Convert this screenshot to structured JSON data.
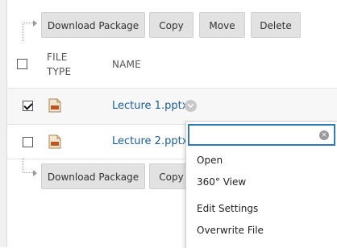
{
  "toolbar_top": {
    "download_label": "Download Package",
    "copy_label": "Copy",
    "move_label": "Move",
    "delete_label": "Delete"
  },
  "table": {
    "col_type_line1": "FILE",
    "col_type_line2": "TYPE",
    "col_name": "NAME",
    "rows": [
      {
        "name": "Lecture 1.pptx",
        "checked": true
      },
      {
        "name": "Lecture 2.pptx",
        "checked": false
      }
    ]
  },
  "toolbar_bottom": {
    "download_label": "Download Package",
    "copy_label": "Copy"
  },
  "context_menu": {
    "search_value": "",
    "clear_symbol": "×",
    "items": [
      "Open",
      "360° View",
      "Edit Settings",
      "Overwrite File"
    ]
  },
  "colors": {
    "link": "#1a5c99",
    "focus_border": "#2e7ab3",
    "button_bg": "#e2e2e2"
  }
}
